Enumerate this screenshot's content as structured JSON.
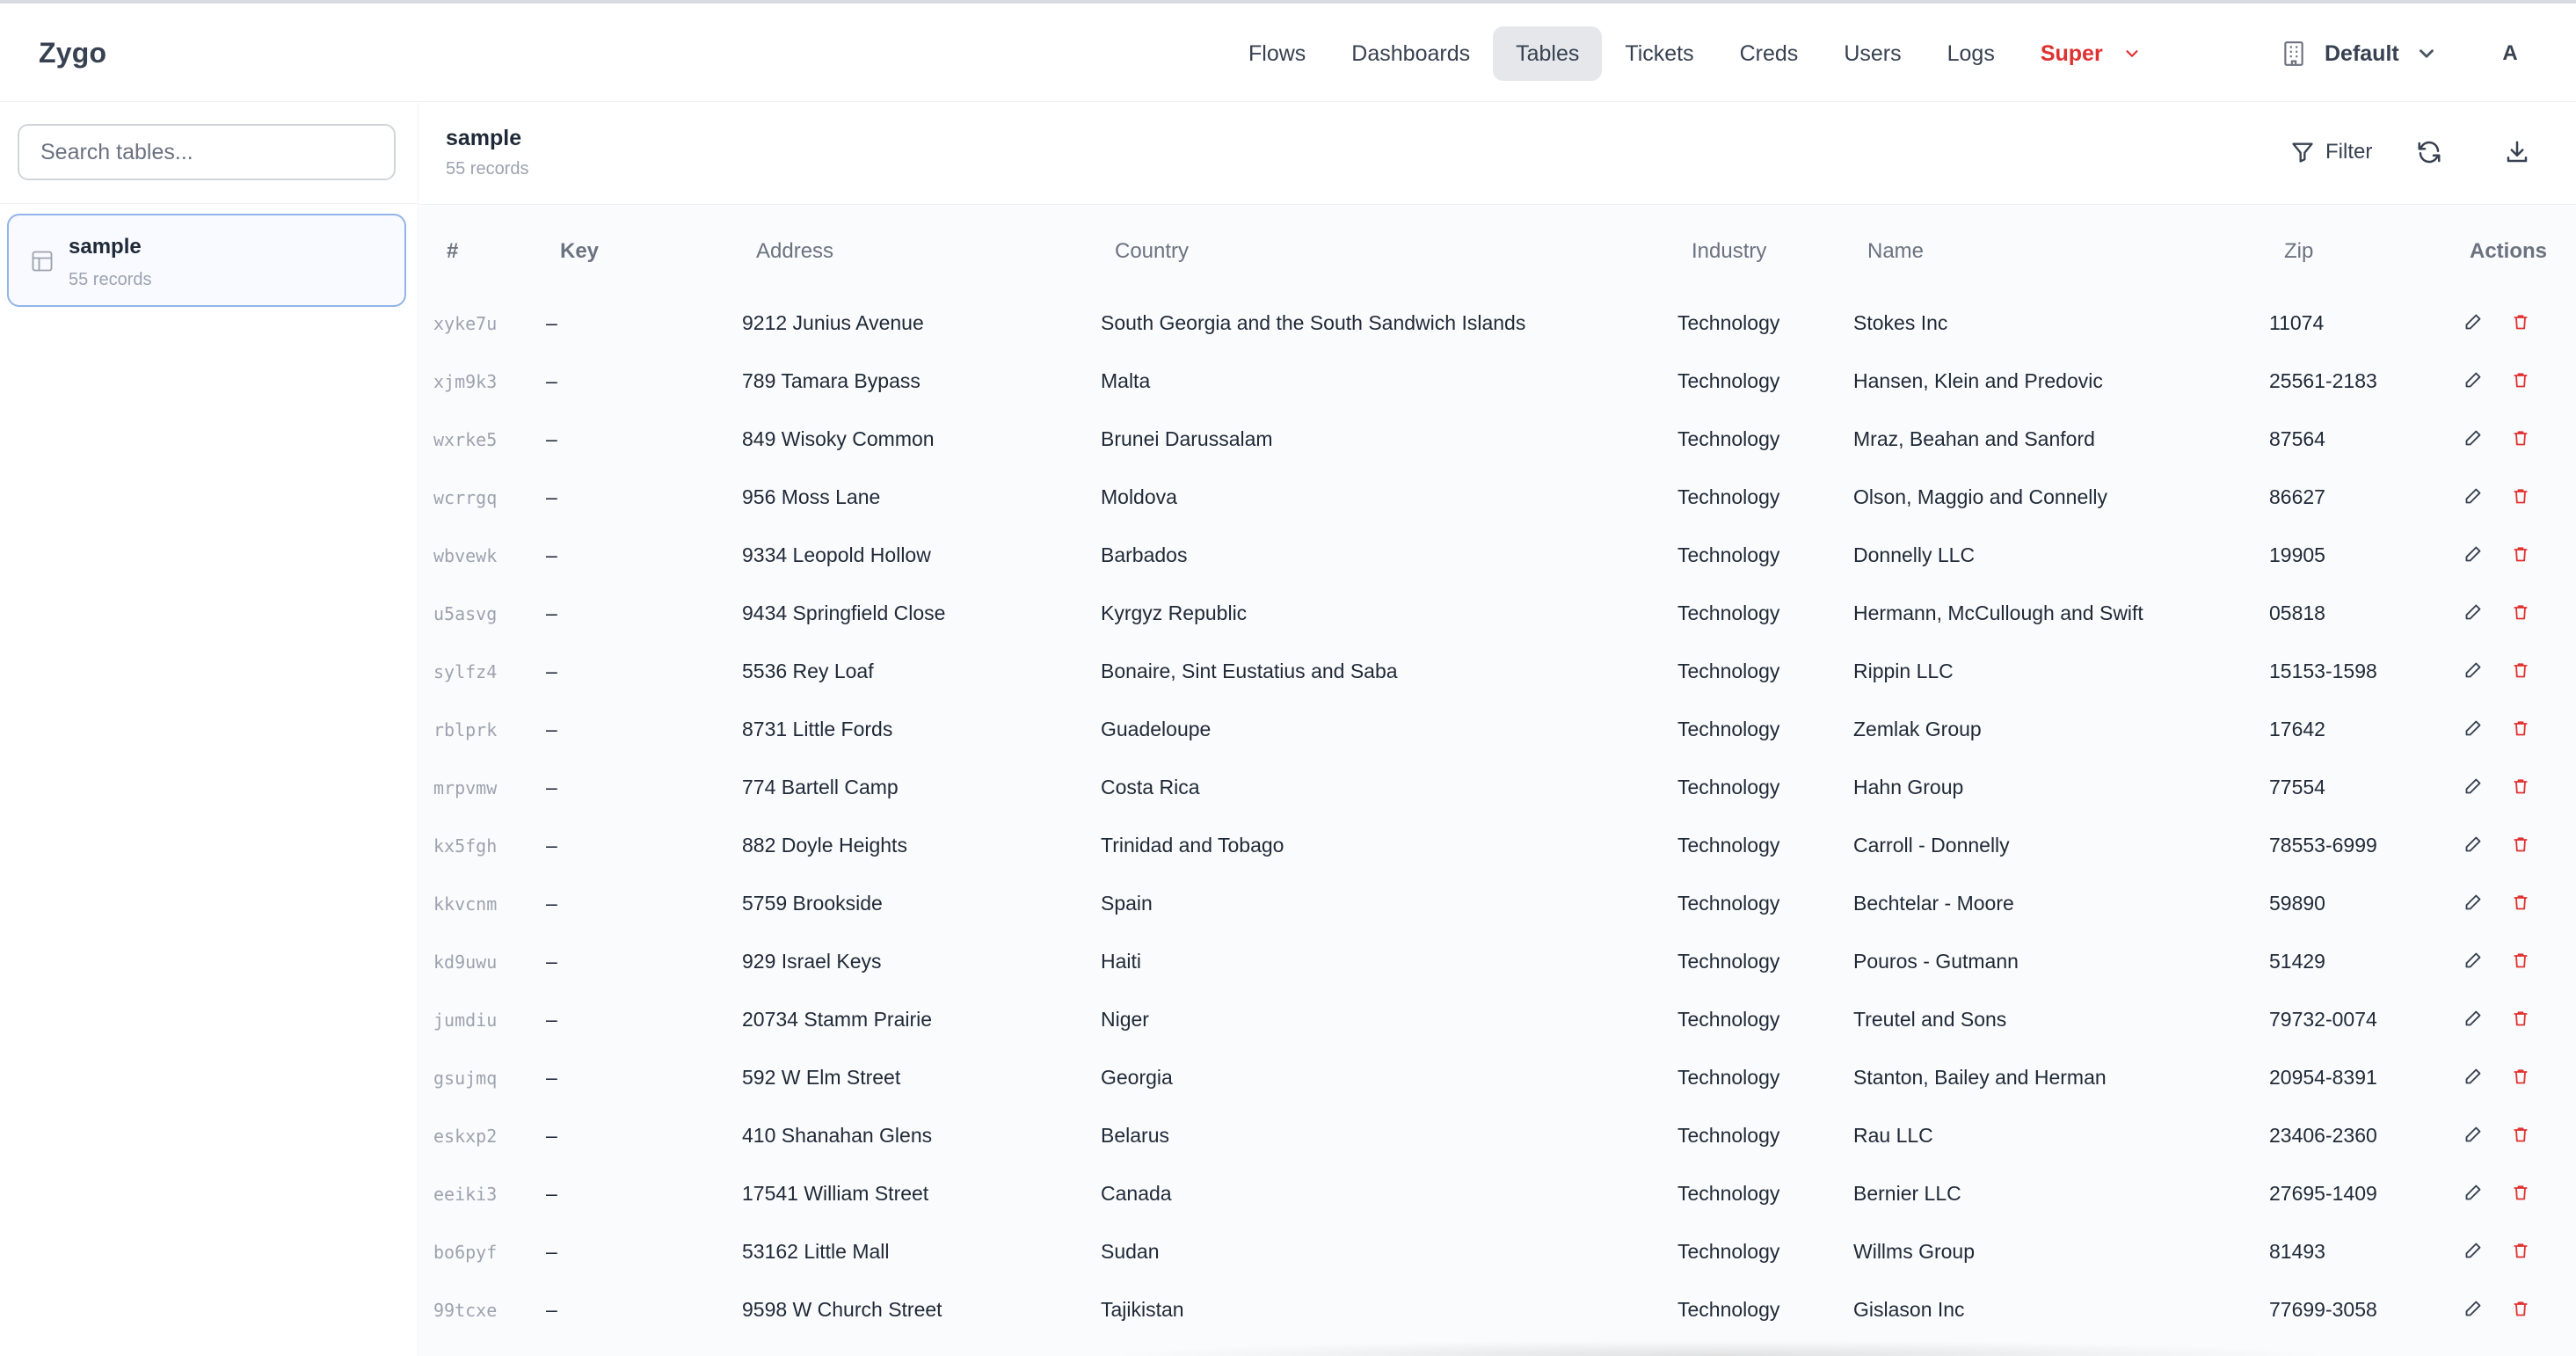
{
  "app": {
    "logo": "Zygo"
  },
  "nav": {
    "items": [
      {
        "label": "Flows",
        "active": false
      },
      {
        "label": "Dashboards",
        "active": false
      },
      {
        "label": "Tables",
        "active": true
      },
      {
        "label": "Tickets",
        "active": false
      },
      {
        "label": "Creds",
        "active": false
      },
      {
        "label": "Users",
        "active": false
      },
      {
        "label": "Logs",
        "active": false
      }
    ],
    "super_label": "Super",
    "workspace": "Default",
    "avatar": "A"
  },
  "colors": {
    "accent_red": "#e03131",
    "selected_border": "#93b4e8",
    "delete_icon": "#e03131"
  },
  "sidebar": {
    "search_placeholder": "Search tables...",
    "tables": [
      {
        "name": "sample",
        "count": "55 records"
      }
    ]
  },
  "main": {
    "title": "sample",
    "count": "55 records",
    "filter_label": "Filter",
    "icons": [
      "filter-icon",
      "refresh-icon",
      "download-icon"
    ]
  },
  "table": {
    "headers": [
      "#",
      "Key",
      "Address",
      "Country",
      "Industry",
      "Name",
      "Zip",
      "Actions"
    ],
    "rows": [
      [
        "xyke7u",
        "–",
        "9212 Junius Avenue",
        "South Georgia and the South Sandwich Islands",
        "Technology",
        "Stokes Inc",
        "11074"
      ],
      [
        "xjm9k3",
        "–",
        "789 Tamara Bypass",
        "Malta",
        "Technology",
        "Hansen, Klein and Predovic",
        "25561-2183"
      ],
      [
        "wxrke5",
        "–",
        "849 Wisoky Common",
        "Brunei Darussalam",
        "Technology",
        "Mraz, Beahan and Sanford",
        "87564"
      ],
      [
        "wcrrgq",
        "–",
        "956 Moss Lane",
        "Moldova",
        "Technology",
        "Olson, Maggio and Connelly",
        "86627"
      ],
      [
        "wbvewk",
        "–",
        "9334 Leopold Hollow",
        "Barbados",
        "Technology",
        "Donnelly LLC",
        "19905"
      ],
      [
        "u5asvg",
        "–",
        "9434 Springfield Close",
        "Kyrgyz Republic",
        "Technology",
        "Hermann, McCullough and Swift",
        "05818"
      ],
      [
        "sylfz4",
        "–",
        "5536 Rey Loaf",
        "Bonaire, Sint Eustatius and Saba",
        "Technology",
        "Rippin LLC",
        "15153-1598"
      ],
      [
        "rblprk",
        "–",
        "8731 Little Fords",
        "Guadeloupe",
        "Technology",
        "Zemlak Group",
        "17642"
      ],
      [
        "mrpvmw",
        "–",
        "774 Bartell Camp",
        "Costa Rica",
        "Technology",
        "Hahn Group",
        "77554"
      ],
      [
        "kx5fgh",
        "–",
        "882 Doyle Heights",
        "Trinidad and Tobago",
        "Technology",
        "Carroll - Donnelly",
        "78553-6999"
      ],
      [
        "kkvcnm",
        "–",
        "5759 Brookside",
        "Spain",
        "Technology",
        "Bechtelar - Moore",
        "59890"
      ],
      [
        "kd9uwu",
        "–",
        "929 Israel Keys",
        "Haiti",
        "Technology",
        "Pouros - Gutmann",
        "51429"
      ],
      [
        "jumdiu",
        "–",
        "20734 Stamm Prairie",
        "Niger",
        "Technology",
        "Treutel and Sons",
        "79732-0074"
      ],
      [
        "gsujmq",
        "–",
        "592 W Elm Street",
        "Georgia",
        "Technology",
        "Stanton, Bailey and Herman",
        "20954-8391"
      ],
      [
        "eskxp2",
        "–",
        "410 Shanahan Glens",
        "Belarus",
        "Technology",
        "Rau LLC",
        "23406-2360"
      ],
      [
        "eeiki3",
        "–",
        "17541 William Street",
        "Canada",
        "Technology",
        "Bernier LLC",
        "27695-1409"
      ],
      [
        "bo6pyf",
        "–",
        "53162 Little Mall",
        "Sudan",
        "Technology",
        "Willms Group",
        "81493"
      ],
      [
        "99tcxe",
        "–",
        "9598 W Church Street",
        "Tajikistan",
        "Technology",
        "Gislason Inc",
        "77699-3058"
      ]
    ]
  }
}
